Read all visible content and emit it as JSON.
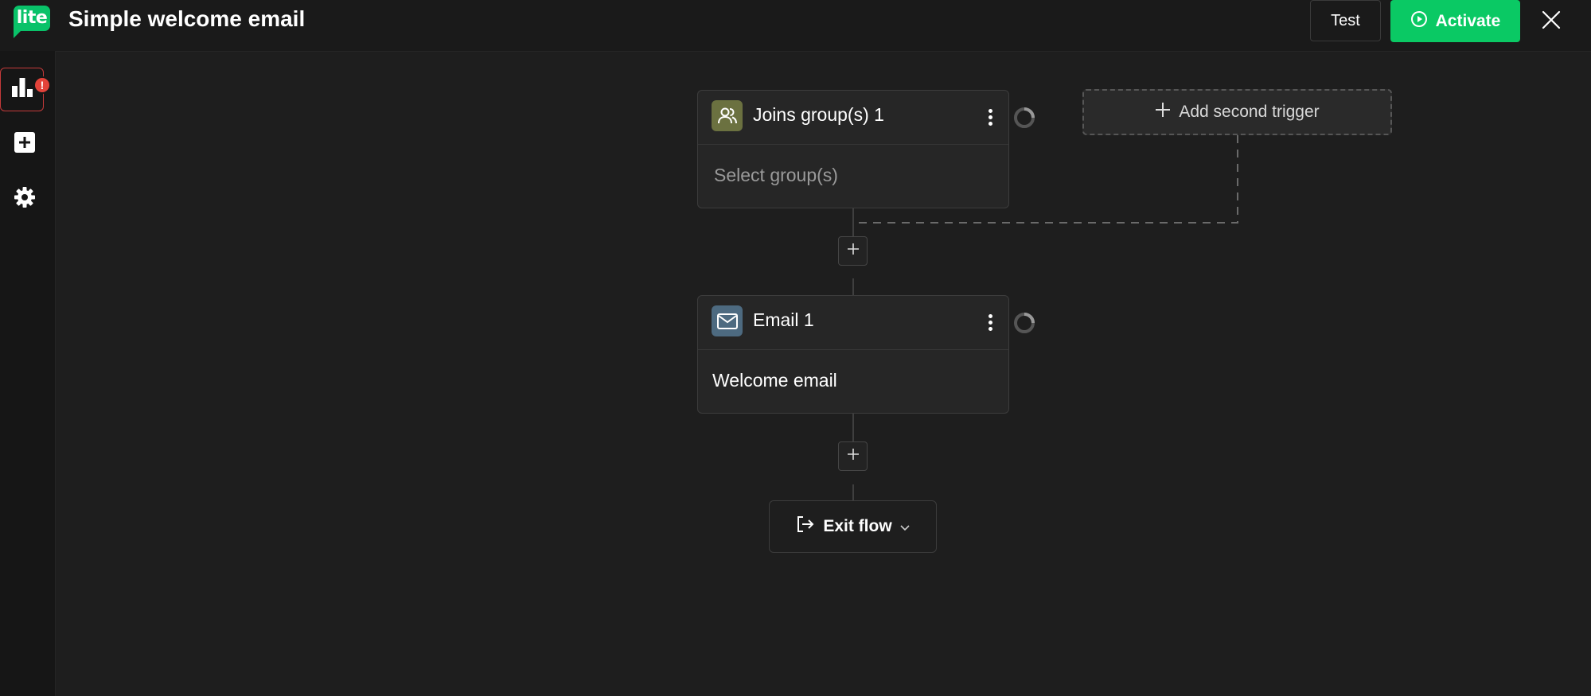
{
  "header": {
    "logo_text": "lite",
    "title": "Simple welcome email",
    "test_label": "Test",
    "activate_label": "Activate"
  },
  "sidebar": {
    "items": [
      {
        "icon": "bar-chart-icon",
        "alert_badge": "!"
      },
      {
        "icon": "plus-square-icon"
      },
      {
        "icon": "gear-icon"
      }
    ]
  },
  "flow": {
    "trigger": {
      "title": "Joins group(s) 1",
      "placeholder": "Select group(s)",
      "icon": "users-icon",
      "icon_color": "#6b7140"
    },
    "add_second_trigger_label": "Add second trigger",
    "step": {
      "title": "Email 1",
      "body": "Welcome email",
      "icon": "envelope-icon",
      "icon_color": "#4d6a80"
    },
    "exit_label": "Exit flow"
  },
  "colors": {
    "accent_green": "#0ac964",
    "logo_green": "#09c269",
    "alert_red": "#e3433a"
  }
}
